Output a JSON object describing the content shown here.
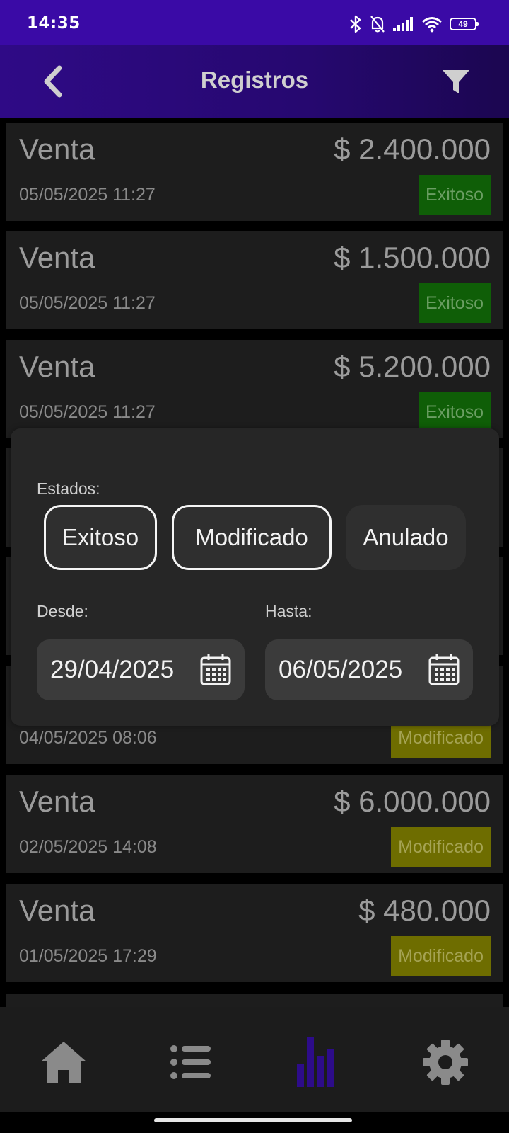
{
  "status_bar": {
    "time": "14:35",
    "battery_level": "49",
    "icons": [
      "bluetooth-icon",
      "bell-muted-icon",
      "signal-icon",
      "wifi-icon",
      "battery-icon"
    ]
  },
  "header": {
    "title": "Registros",
    "back_icon": "chevron-left-icon",
    "filter_icon": "filter-icon"
  },
  "records": [
    {
      "type": "Venta",
      "amount": "$ 2.400.000",
      "date": "05/05/2025 11:27",
      "status": "Exitoso"
    },
    {
      "type": "Venta",
      "amount": "$ 1.500.000",
      "date": "05/05/2025 11:27",
      "status": "Exitoso"
    },
    {
      "type": "Venta",
      "amount": "$ 5.200.000",
      "date": "05/05/2025 11:27",
      "status": "Exitoso"
    },
    {
      "type": "",
      "amount": "",
      "date": "04/05/2025 08:06",
      "status": "Modificado"
    },
    {
      "type": "Venta",
      "amount": "$ 6.000.000",
      "date": "02/05/2025 14:08",
      "status": "Modificado"
    },
    {
      "type": "Venta",
      "amount": "$ 480.000",
      "date": "01/05/2025 17:29",
      "status": "Modificado"
    }
  ],
  "filter_dialog": {
    "states_label": "Estados:",
    "chips": [
      {
        "label": "Exitoso",
        "selected": true
      },
      {
        "label": "Modificado",
        "selected": true
      },
      {
        "label": "Anulado",
        "selected": false
      }
    ],
    "from_label": "Desde:",
    "to_label": "Hasta:",
    "from_value": "29/04/2025",
    "to_value": "06/05/2025",
    "calendar_icon": "calendar-icon"
  },
  "bottom_nav": {
    "items": [
      {
        "icon": "home-icon",
        "active": false
      },
      {
        "icon": "list-icon",
        "active": false
      },
      {
        "icon": "bar-chart-icon",
        "active": true
      },
      {
        "icon": "gear-icon",
        "active": false
      }
    ]
  },
  "colors": {
    "status_bar": "#3a0aa6",
    "app_bar": "#2f0a86",
    "success_badge": "#0f5e07",
    "modified_badge": "#6e6d00",
    "active_nav": "#2d0c8a"
  }
}
